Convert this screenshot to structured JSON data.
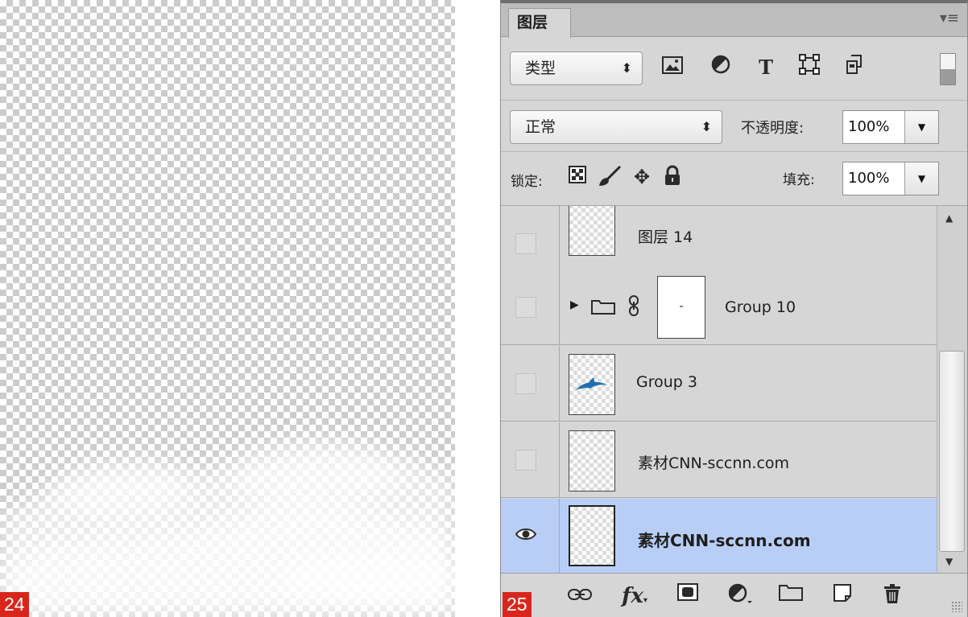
{
  "figures": {
    "left_number": "24",
    "right_number": "25"
  },
  "panel": {
    "tab_label": "图层",
    "menu_icon": "panel-menu-icon",
    "filter": {
      "select_label": "类型",
      "icons": [
        "image-filter-icon",
        "adjustment-filter-icon",
        "type-filter-icon",
        "shape-filter-icon",
        "smart-object-filter-icon"
      ],
      "type_glyph": "T"
    },
    "blend": {
      "mode": "正常",
      "opacity_label": "不透明度:",
      "opacity_value": "100%"
    },
    "lock": {
      "label": "锁定:",
      "fill_label": "填充:",
      "fill_value": "100%"
    },
    "layers": [
      {
        "name": "图层 14",
        "visible": false,
        "selected": false
      },
      {
        "name": "Group 10",
        "visible": false,
        "selected": false,
        "type": "group",
        "mask_dot": "-"
      },
      {
        "name": "Group 3",
        "visible": false,
        "selected": false
      },
      {
        "name": "素材CNN-sccnn.com",
        "visible": false,
        "selected": false
      },
      {
        "name": "素材CNN-sccnn.com",
        "visible": true,
        "selected": true
      }
    ],
    "bottom_icons": [
      "link-layers-icon",
      "fx-icon",
      "add-mask-icon",
      "adjustment-layer-icon",
      "new-group-icon",
      "new-layer-icon",
      "delete-layer-icon"
    ],
    "fx_label": "fx"
  },
  "colors": {
    "figure_badge": "#d9261c",
    "selected_layer": "#b8cef6",
    "panel_bg": "#d6d6d6"
  }
}
